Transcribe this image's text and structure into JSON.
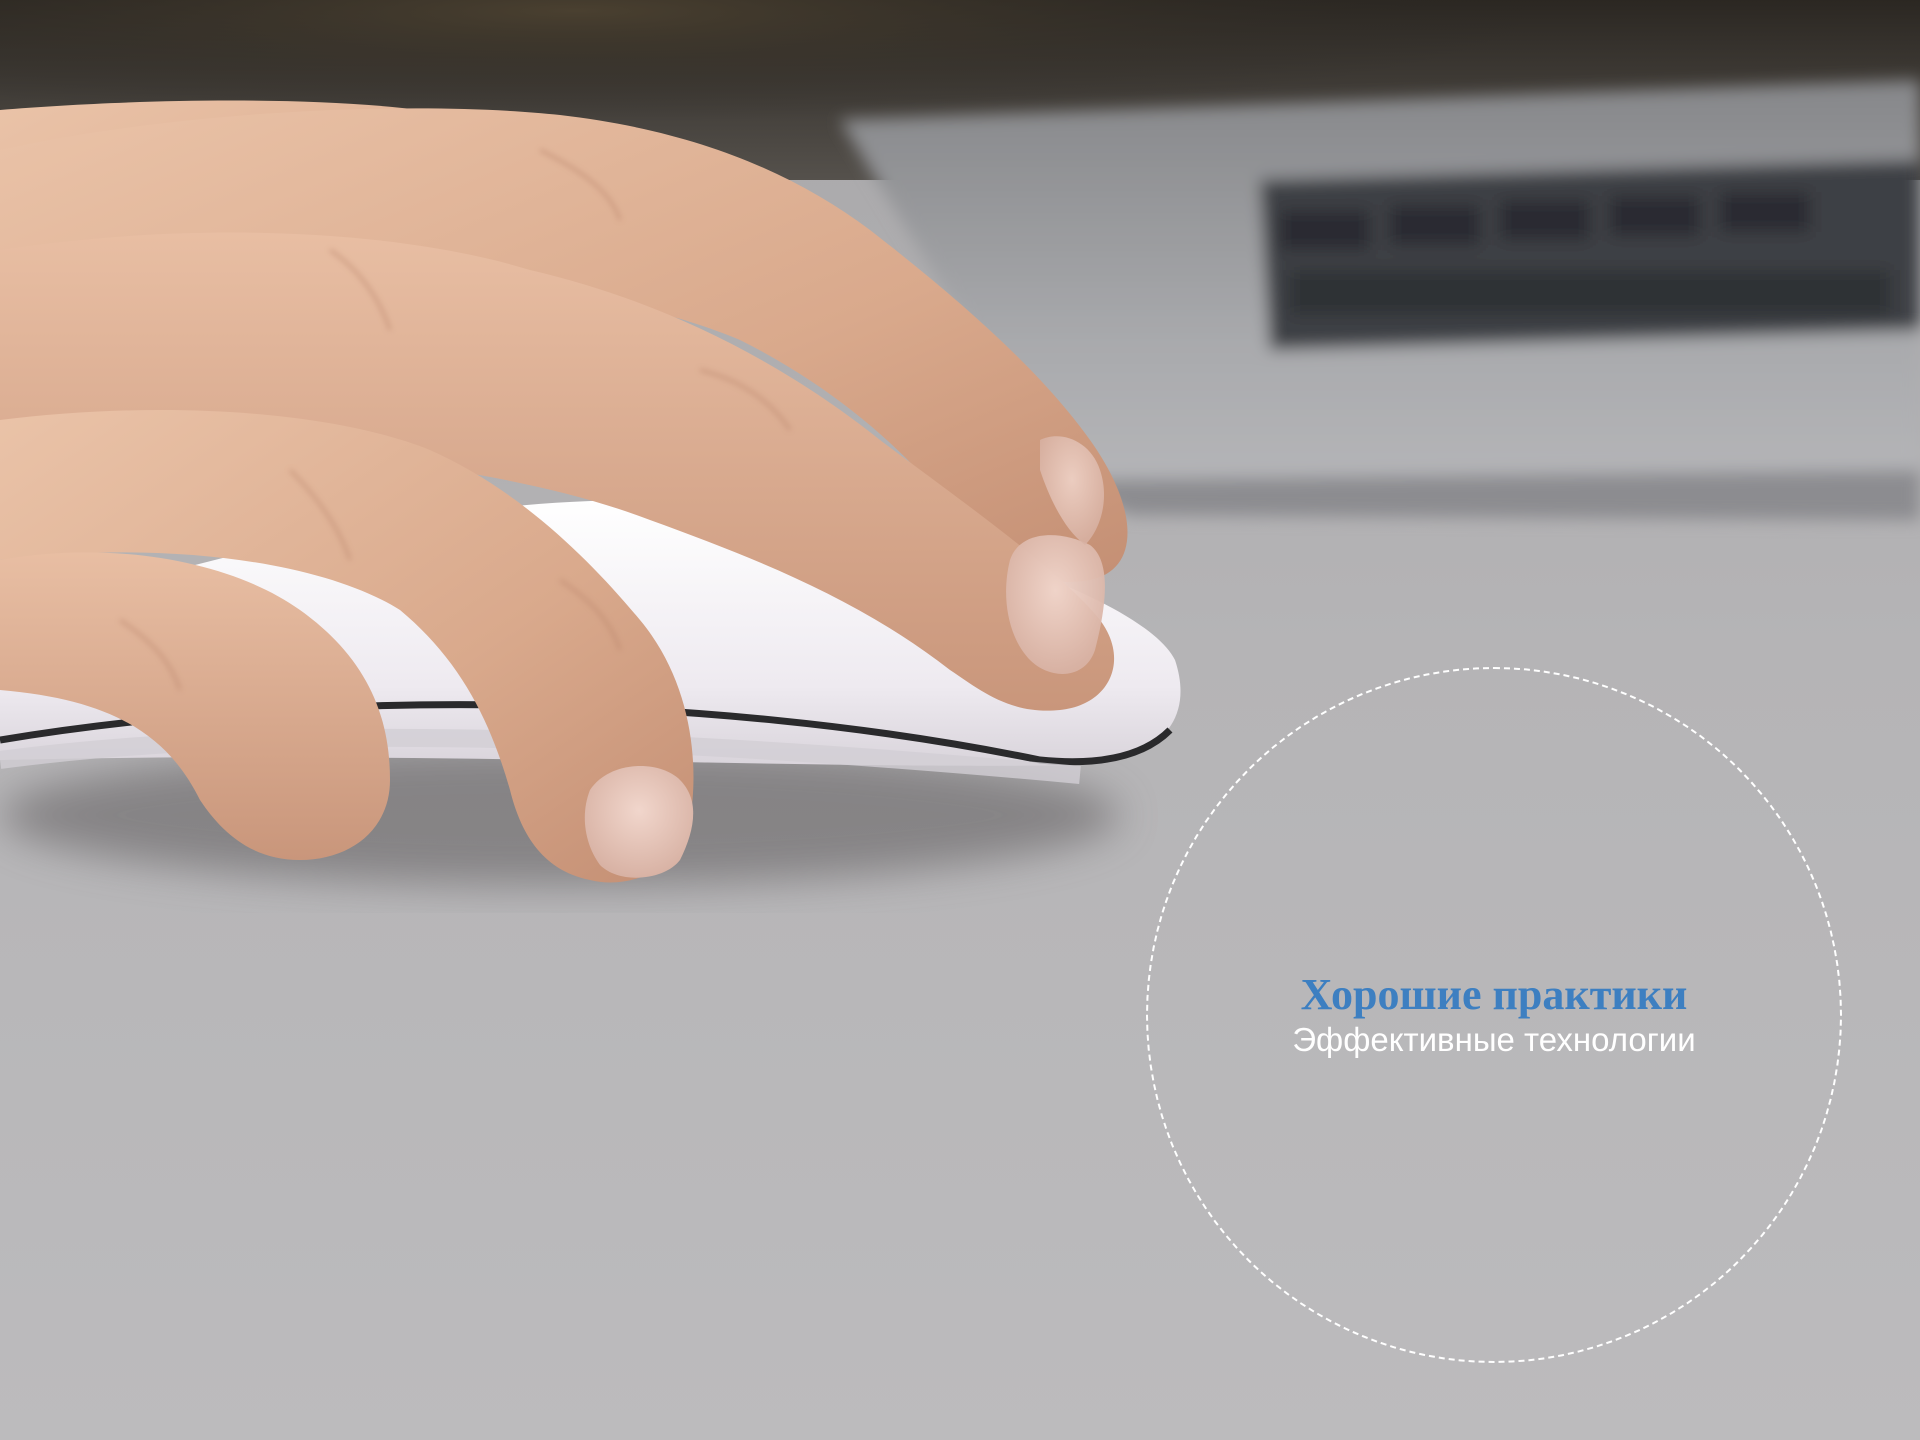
{
  "badge": {
    "title": "Хорошие практики",
    "subtitle": "Эффективные технологии",
    "title_color": "#3d7fc1",
    "subtitle_color": "#ffffff",
    "border_style": "dashed",
    "border_color": "#ffffff"
  },
  "photo": {
    "subject": "hand-on-computer-mouse",
    "colors": {
      "desk": "#b9b8b9",
      "skin": "#e0b397",
      "mouse": "#f5f3f6",
      "laptop": "#9a9a9c",
      "background_dark": "#2e2a24"
    }
  }
}
